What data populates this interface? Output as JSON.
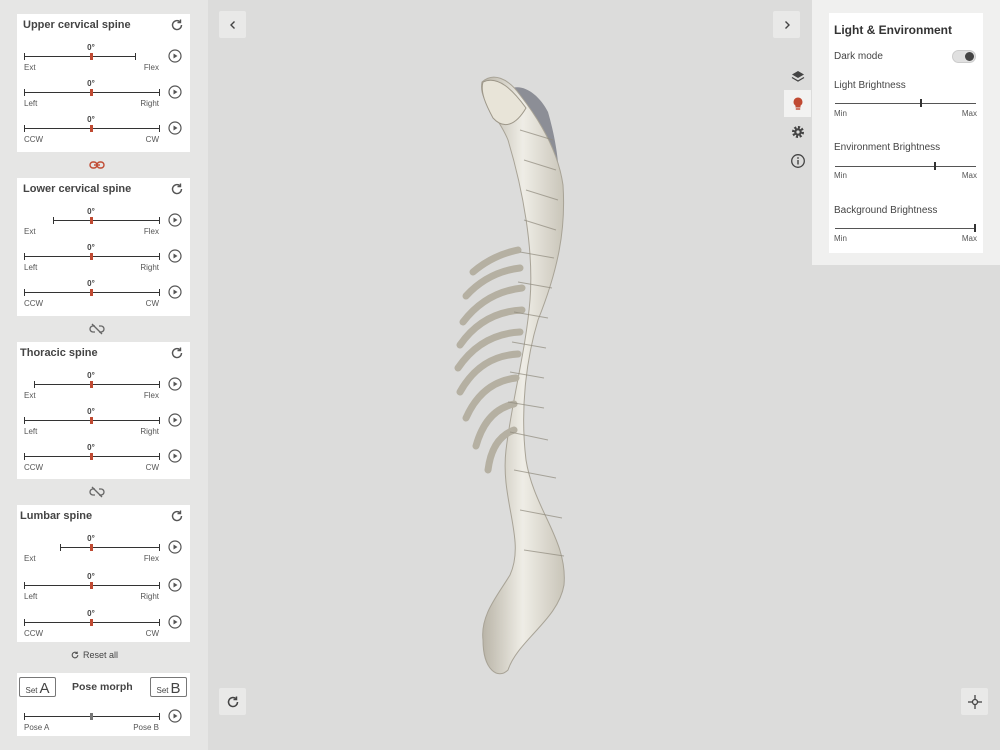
{
  "left_panel": {
    "groups": [
      {
        "title": "Upper cervical spine",
        "sliders": [
          {
            "value": "0°",
            "left": "Ext",
            "right": "Flex"
          },
          {
            "value": "0°",
            "left": "Left",
            "right": "Right"
          },
          {
            "value": "0°",
            "left": "CCW",
            "right": "CW"
          }
        ]
      },
      {
        "title": "Lower cervical spine",
        "sliders": [
          {
            "value": "0°",
            "left": "Ext",
            "right": "Flex"
          },
          {
            "value": "0°",
            "left": "Left",
            "right": "Right"
          },
          {
            "value": "0°",
            "left": "CCW",
            "right": "CW"
          }
        ]
      },
      {
        "title": "Thoracic spine",
        "sliders": [
          {
            "value": "0°",
            "left": "Ext",
            "right": "Flex"
          },
          {
            "value": "0°",
            "left": "Left",
            "right": "Right"
          },
          {
            "value": "0°",
            "left": "CCW",
            "right": "CW"
          }
        ]
      },
      {
        "title": "Lumbar spine",
        "sliders": [
          {
            "value": "0°",
            "left": "Ext",
            "right": "Flex"
          },
          {
            "value": "0°",
            "left": "Left",
            "right": "Right"
          },
          {
            "value": "0°",
            "left": "CCW",
            "right": "CW"
          }
        ]
      }
    ],
    "reset_all": "Reset all",
    "pose_morph": {
      "title": "Pose morph",
      "set_a_small": "Set",
      "set_a_letter": "A",
      "set_b_small": "Set",
      "set_b_letter": "B",
      "left": "Pose A",
      "right": "Pose B"
    }
  },
  "right_panel": {
    "title": "Light & Environment",
    "dark_mode_label": "Dark mode",
    "dark_mode_on": true,
    "sliders": [
      {
        "label": "Light Brightness",
        "min": "Min",
        "max": "Max",
        "level": 0.61
      },
      {
        "label": "Environment Brightness",
        "min": "Min",
        "max": "Max",
        "level": 0.71
      },
      {
        "label": "Background Brightness",
        "min": "Min",
        "max": "Max",
        "level": 1.0
      }
    ]
  },
  "colors": {
    "accent": "#c04a32",
    "panel": "#e6e6e5",
    "viewport": "#dcdcdb"
  }
}
